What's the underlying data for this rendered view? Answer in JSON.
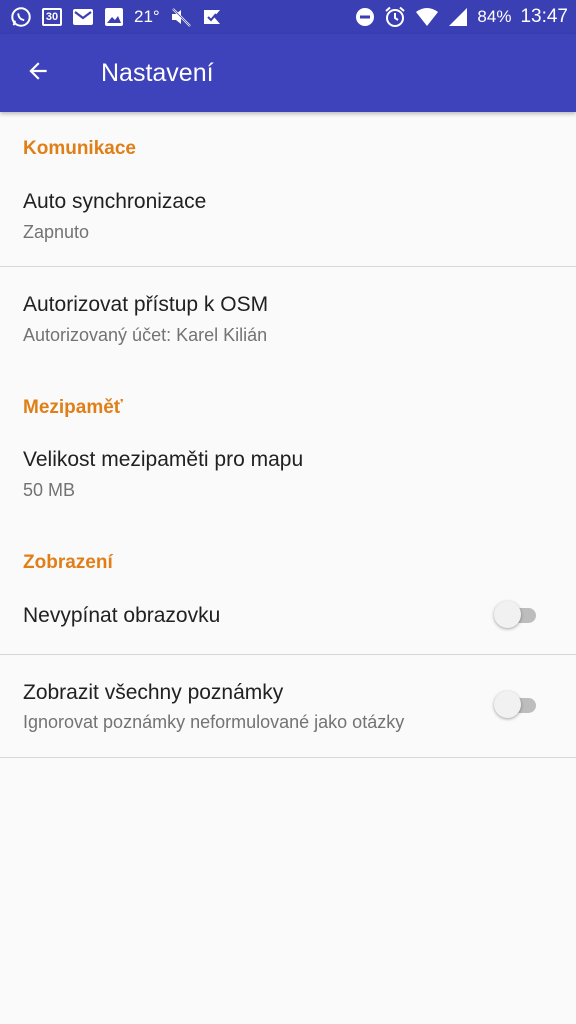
{
  "status_bar": {
    "calendar_day": "30",
    "temperature": "21°",
    "battery": "84%",
    "time": "13:47",
    "icons": [
      "whatsapp-icon",
      "calendar-icon",
      "gmail-icon",
      "image-icon",
      "mute-icon",
      "tick-icon",
      "dnd-icon",
      "alarm-icon",
      "wifi-icon",
      "signal-icon"
    ]
  },
  "app_bar": {
    "title": "Nastavení",
    "back_icon": "arrow-back-icon",
    "color": "#3f43bb"
  },
  "accent_color": "#e07f18",
  "sections": [
    {
      "header": "Komunikace",
      "items": [
        {
          "title": "Auto synchronizace",
          "summary": "Zapnuto"
        },
        {
          "title": "Autorizovat přístup k OSM",
          "summary": "Autorizovaný účet: Karel Kilián"
        }
      ]
    },
    {
      "header": "Mezipaměť",
      "items": [
        {
          "title": "Velikost mezipaměti pro mapu",
          "summary": "50 MB"
        }
      ]
    },
    {
      "header": "Zobrazení",
      "items": [
        {
          "title": "Nevypínat obrazovku",
          "summary": "",
          "switch_on": false
        },
        {
          "title": "Zobrazit všechny poznámky",
          "summary": "Ignorovat poznámky neformulované jako otázky",
          "switch_on": false
        }
      ]
    }
  ]
}
